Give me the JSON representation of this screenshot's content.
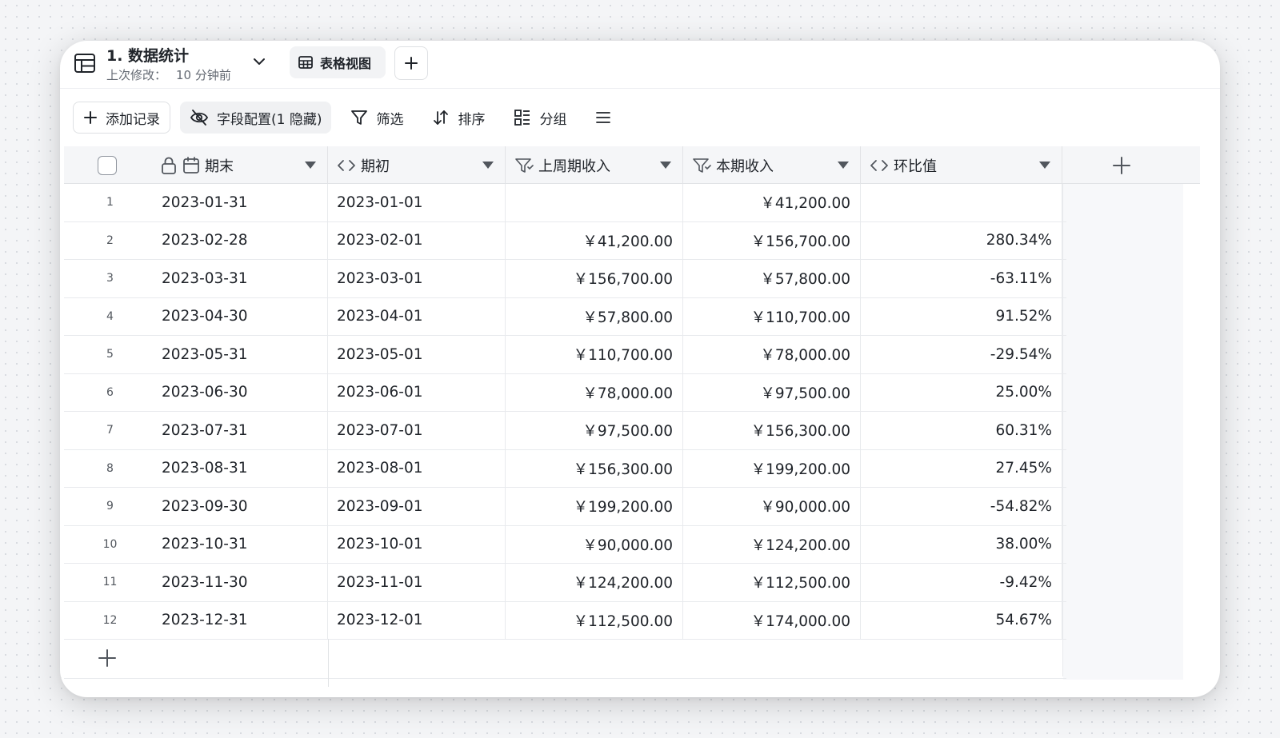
{
  "header": {
    "title": "1. 数据统计",
    "subtitle_label": "上次修改：",
    "subtitle_value": "10 分钟前",
    "view_tab_label": "表格视图"
  },
  "toolbar": {
    "add_record": "添加记录",
    "field_config": "字段配置(1 隐藏)",
    "filter": "筛选",
    "sort": "排序",
    "group": "分组"
  },
  "columns": [
    {
      "label": "期末",
      "icon": "calendar-icon"
    },
    {
      "label": "期初",
      "icon": "code-icon"
    },
    {
      "label": "上周期收入",
      "icon": "lookup-filter-icon"
    },
    {
      "label": "本期收入",
      "icon": "lookup-filter-icon"
    },
    {
      "label": "环比值",
      "icon": "code-icon"
    }
  ],
  "rows": [
    {
      "n": "1",
      "end": "2023-01-31",
      "start": "2023-01-01",
      "prev": "",
      "curr": "￥41,200.00",
      "ratio": ""
    },
    {
      "n": "2",
      "end": "2023-02-28",
      "start": "2023-02-01",
      "prev": "￥41,200.00",
      "curr": "￥156,700.00",
      "ratio": "280.34%"
    },
    {
      "n": "3",
      "end": "2023-03-31",
      "start": "2023-03-01",
      "prev": "￥156,700.00",
      "curr": "￥57,800.00",
      "ratio": "-63.11%"
    },
    {
      "n": "4",
      "end": "2023-04-30",
      "start": "2023-04-01",
      "prev": "￥57,800.00",
      "curr": "￥110,700.00",
      "ratio": "91.52%"
    },
    {
      "n": "5",
      "end": "2023-05-31",
      "start": "2023-05-01",
      "prev": "￥110,700.00",
      "curr": "￥78,000.00",
      "ratio": "-29.54%"
    },
    {
      "n": "6",
      "end": "2023-06-30",
      "start": "2023-06-01",
      "prev": "￥78,000.00",
      "curr": "￥97,500.00",
      "ratio": "25.00%"
    },
    {
      "n": "7",
      "end": "2023-07-31",
      "start": "2023-07-01",
      "prev": "￥97,500.00",
      "curr": "￥156,300.00",
      "ratio": "60.31%"
    },
    {
      "n": "8",
      "end": "2023-08-31",
      "start": "2023-08-01",
      "prev": "￥156,300.00",
      "curr": "￥199,200.00",
      "ratio": "27.45%"
    },
    {
      "n": "9",
      "end": "2023-09-30",
      "start": "2023-09-01",
      "prev": "￥199,200.00",
      "curr": "￥90,000.00",
      "ratio": "-54.82%"
    },
    {
      "n": "10",
      "end": "2023-10-31",
      "start": "2023-10-01",
      "prev": "￥90,000.00",
      "curr": "￥124,200.00",
      "ratio": "38.00%"
    },
    {
      "n": "11",
      "end": "2023-11-30",
      "start": "2023-11-01",
      "prev": "￥124,200.00",
      "curr": "￥112,500.00",
      "ratio": "-9.42%"
    },
    {
      "n": "12",
      "end": "2023-12-31",
      "start": "2023-12-01",
      "prev": "￥112,500.00",
      "curr": "￥174,000.00",
      "ratio": "54.67%"
    }
  ]
}
